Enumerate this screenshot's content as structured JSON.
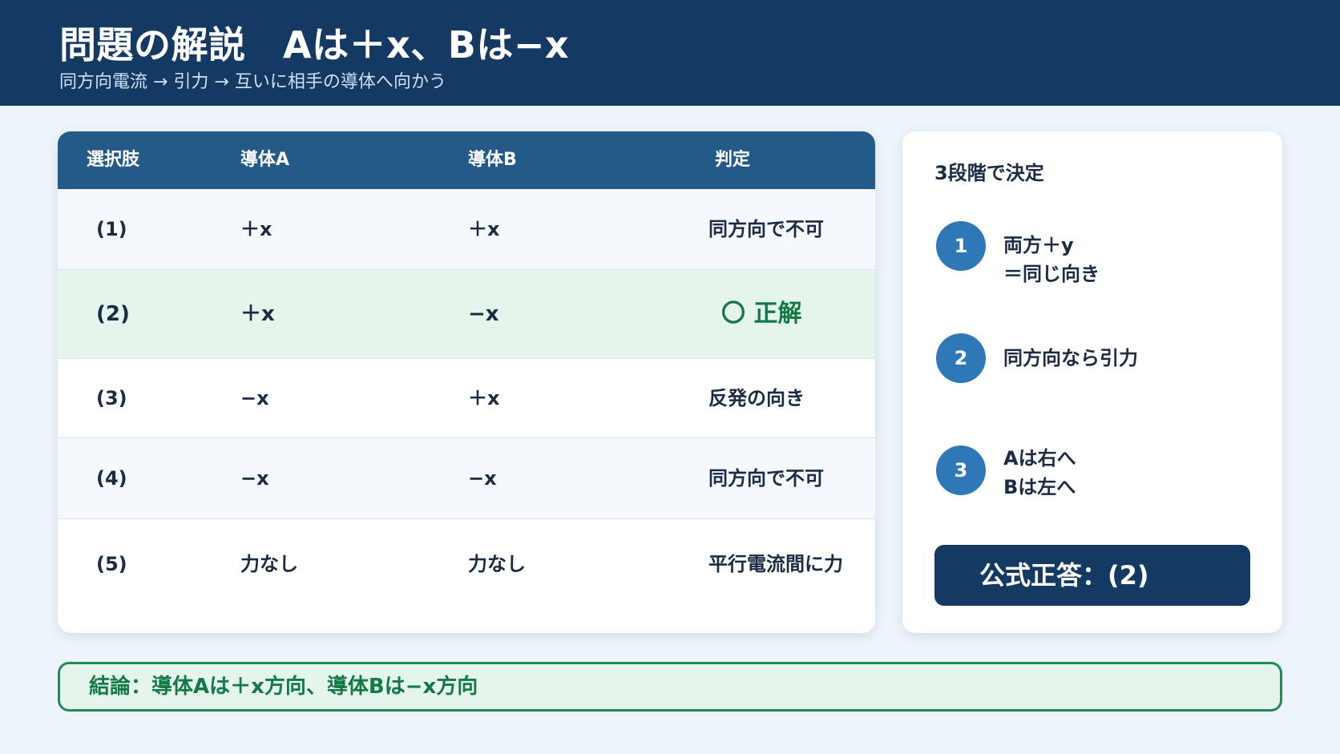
{
  "header": {
    "title": "問題の解説　Aは＋x、Bは−x",
    "subtitle": "同方向電流 → 引力 → 互いに相手の導体へ向かう"
  },
  "table": {
    "headers": [
      "選択肢",
      "導体A",
      "導体B",
      "判定"
    ],
    "rows": [
      {
        "option": "(1)",
        "a": "＋x",
        "b": "＋x",
        "verdict": "同方向で不可"
      },
      {
        "option": "(2)",
        "a": "＋x",
        "b": "−x",
        "verdict": "〇 正解"
      },
      {
        "option": "(3)",
        "a": "−x",
        "b": "＋x",
        "verdict": "反発の向き"
      },
      {
        "option": "(4)",
        "a": "−x",
        "b": "−x",
        "verdict": "同方向で不可"
      },
      {
        "option": "(5)",
        "a": "力なし",
        "b": "力なし",
        "verdict": "平行電流間に力"
      }
    ]
  },
  "side": {
    "title": "3段階で決定",
    "steps": [
      {
        "num": "1",
        "line1": "両方＋y",
        "line2": "＝同じ向き"
      },
      {
        "num": "2",
        "line1": "同方向なら引力",
        "line2": ""
      },
      {
        "num": "3",
        "line1": "Aは右へ",
        "line2": "Bは左へ"
      }
    ],
    "answer": "公式正答：(2)"
  },
  "conclusion": "結論：導体Aは＋x方向、導体Bは−x方向",
  "colors": {
    "header_bg": "#143a64",
    "table_header_bg": "#245a87",
    "correct_row_bg": "#e6f5ec",
    "correct_text": "#137a47",
    "step_circle": "#2e78b7"
  }
}
